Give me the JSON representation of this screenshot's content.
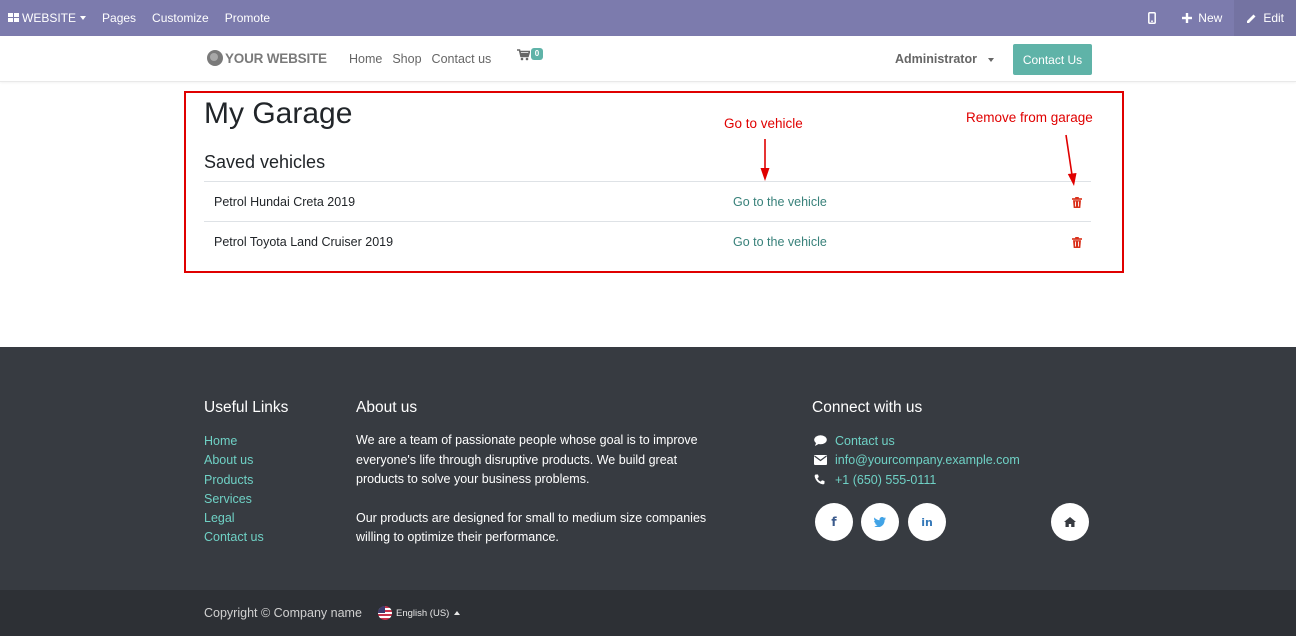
{
  "editbar": {
    "website_label": "WEBSITE",
    "pages_label": "Pages",
    "customize_label": "Customize",
    "promote_label": "Promote",
    "new_label": "New",
    "edit_label": "Edit"
  },
  "header": {
    "logo_text": "YOUR WEBSITE",
    "nav": [
      "Home",
      "Shop",
      "Contact us"
    ],
    "cart_count": "0",
    "user_label": "Administrator",
    "contact_button": "Contact Us"
  },
  "garage": {
    "title": "My Garage",
    "subtitle": "Saved vehicles",
    "vehicles": [
      {
        "name": "Petrol Hundai Creta 2019",
        "link": "Go to the vehicle"
      },
      {
        "name": "Petrol Toyota Land Cruiser 2019",
        "link": "Go to the vehicle"
      }
    ],
    "annotation_go": "Go to vehicle",
    "annotation_remove": "Remove from garage"
  },
  "footer": {
    "useful_links_title": "Useful Links",
    "useful_links": [
      "Home",
      "About us",
      "Products",
      "Services",
      "Legal",
      "Contact us"
    ],
    "about_title": "About us",
    "about_p1": "We are a team of passionate people whose goal is to improve everyone's life through disruptive products. We build great products to solve your business problems.",
    "about_p2": "Our products are designed for small to medium size companies willing to optimize their performance.",
    "connect_title": "Connect with us",
    "connect_contact": "Contact us",
    "connect_email": "info@yourcompany.example.com",
    "connect_phone": "+1 (650) 555-0111",
    "copyright": "Copyright © Company name",
    "language": "English (US)"
  },
  "colors": {
    "editbar": "#7c7bad",
    "accent": "#5fb3a8",
    "link": "#38817a",
    "footer_bg": "#373b41",
    "footer_link": "#6fd1c5",
    "annotation": "#e00000"
  }
}
